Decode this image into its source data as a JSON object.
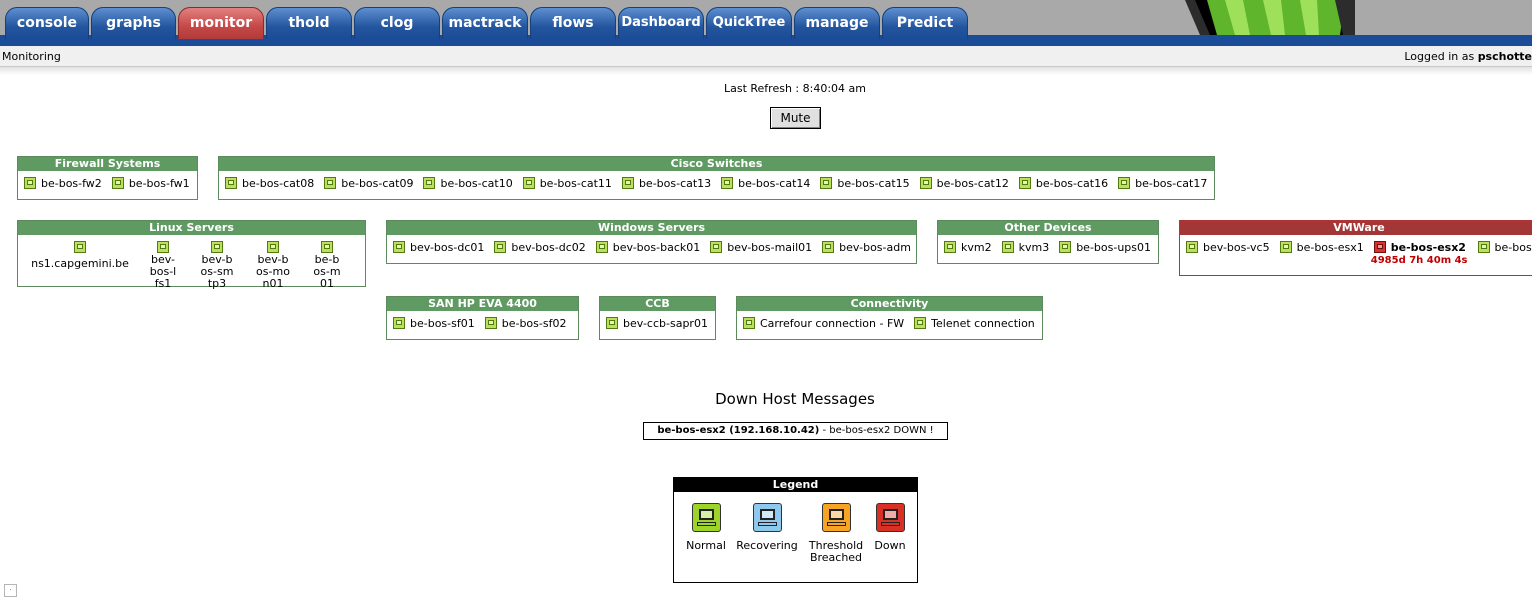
{
  "tabs": [
    "console",
    "graphs",
    "monitor",
    "thold",
    "clog",
    "mactrack",
    "flows",
    "Dashboard",
    "QuickTree",
    "manage",
    "Predict"
  ],
  "breadcrumb": "Monitoring",
  "login": {
    "prefix": "Logged in as",
    "user": "pschotte"
  },
  "last_refresh": "Last Refresh : 8:40:04 am",
  "mute_label": "Mute",
  "groups": {
    "firewall": {
      "title": "Firewall Systems",
      "hosts": [
        "be-bos-fw2",
        "be-bos-fw1"
      ]
    },
    "cisco": {
      "title": "Cisco Switches",
      "hosts": [
        "be-bos-cat08",
        "be-bos-cat09",
        "be-bos-cat10",
        "be-bos-cat11",
        "be-bos-cat13",
        "be-bos-cat14",
        "be-bos-cat15",
        "be-bos-cat12",
        "be-bos-cat16",
        "be-bos-cat17"
      ]
    },
    "linux": {
      "title": "Linux Servers",
      "hosts": [
        "ns1.capgemini.be",
        "bev-bos-lfs1",
        "bev-bos-smtp3",
        "bev-bos-mon01",
        "be-bos-m01"
      ]
    },
    "windows": {
      "title": "Windows Servers",
      "hosts": [
        "bev-bos-dc01",
        "bev-bos-dc02",
        "bev-bos-back01",
        "bev-bos-mail01",
        "bev-bos-adm"
      ]
    },
    "other": {
      "title": "Other Devices",
      "hosts": [
        "kvm2",
        "kvm3",
        "be-bos-ups01"
      ]
    },
    "vmware": {
      "title": "VMWare",
      "hosts": [
        "bev-bos-vc5",
        "be-bos-esx1",
        "be-bos-esx2",
        "be-bos"
      ],
      "down_time": "4985d 7h 40m 4s"
    },
    "san": {
      "title": "SAN HP EVA 4400",
      "hosts": [
        "be-bos-sf01",
        "be-bos-sf02"
      ]
    },
    "ccb": {
      "title": "CCB",
      "hosts": [
        "bev-ccb-sapr01"
      ]
    },
    "connectivity": {
      "title": "Connectivity",
      "hosts": [
        "Carrefour connection - FW",
        "Telenet connection"
      ]
    }
  },
  "down_messages": {
    "title": "Down Host Messages",
    "host": "be-bos-esx2 (192.168.10.42)",
    "text": "- be-bos-esx2 DOWN !"
  },
  "legend": {
    "title": "Legend",
    "items": [
      {
        "label": "Normal",
        "color": "#9ed32a"
      },
      {
        "label": "Recovering",
        "color": "#8ec8ee"
      },
      {
        "label": "Threshold Breached",
        "color": "#f7a325"
      },
      {
        "label": "Down",
        "color": "#d93025"
      }
    ]
  }
}
